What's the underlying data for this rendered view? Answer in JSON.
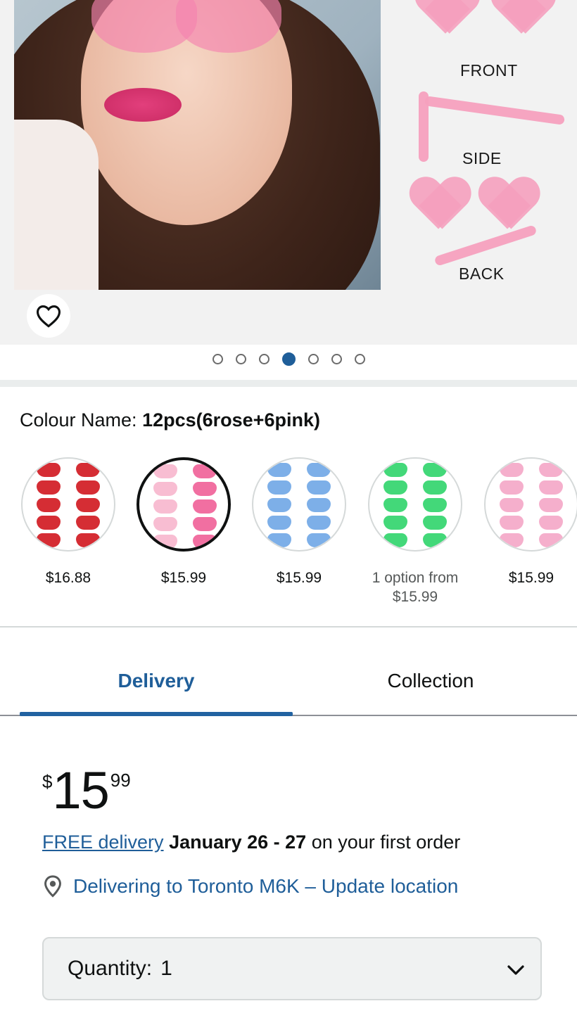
{
  "gallery": {
    "views": [
      "FRONT",
      "SIDE",
      "BACK"
    ],
    "image_count": 7,
    "active_index": 3
  },
  "variant": {
    "label": "Colour Name:",
    "selected": "12pcs(6rose+6pink)",
    "options": [
      {
        "color": "red",
        "price": "$16.88"
      },
      {
        "color": "rose-pink",
        "price": "$15.99",
        "selected": true
      },
      {
        "color": "blue",
        "price": "$15.99"
      },
      {
        "color": "green",
        "price_line1": "1 option from",
        "price": "$15.99"
      },
      {
        "color": "light-pink",
        "price": "$15.99"
      }
    ]
  },
  "tabs": {
    "delivery": "Delivery",
    "collection": "Collection",
    "active": "Delivery"
  },
  "price": {
    "symbol": "$",
    "whole": "15",
    "fraction": "99"
  },
  "delivery": {
    "link": "FREE delivery",
    "dates": "January 26 - 27",
    "suffix": "on your first order"
  },
  "location": {
    "text": "Delivering to Toronto M6K – Update location"
  },
  "quantity": {
    "label": "Quantity:",
    "value": "1"
  },
  "colors": {
    "accent": "#1f5e99",
    "text": "#0f1111",
    "muted": "#565959"
  }
}
